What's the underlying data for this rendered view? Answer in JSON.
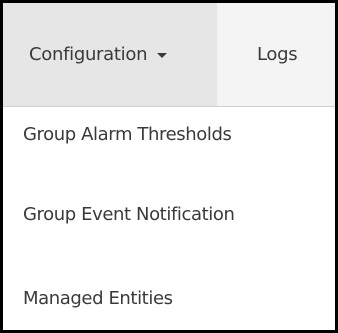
{
  "nav": {
    "configuration_label": "Configuration",
    "logs_label": "Logs"
  },
  "dropdown": {
    "items": [
      {
        "label": "Group Alarm Thresholds"
      },
      {
        "label": "Group Event Notification"
      },
      {
        "label": "Managed Entities"
      }
    ]
  },
  "icons": {
    "configuration_caret": "chevron-down-icon"
  }
}
